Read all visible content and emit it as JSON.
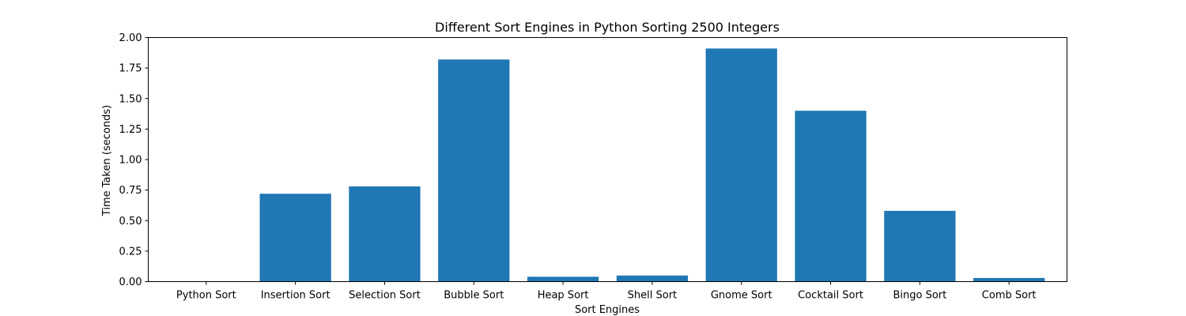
{
  "chart_data": {
    "type": "bar",
    "title": "Different Sort Engines in Python Sorting 2500 Integers",
    "xlabel": "Sort Engines",
    "ylabel": "Time Taken (seconds)",
    "categories": [
      "Python Sort",
      "Insertion Sort",
      "Selection Sort",
      "Bubble Sort",
      "Heap Sort",
      "Shell Sort",
      "Gnome Sort",
      "Cocktail Sort",
      "Bingo Sort",
      "Comb Sort"
    ],
    "values": [
      0.0,
      0.72,
      0.78,
      1.82,
      0.04,
      0.05,
      1.91,
      1.4,
      0.58,
      0.03
    ],
    "ylim": [
      0,
      2.0
    ],
    "yticks": [
      "0.00",
      "0.25",
      "0.50",
      "0.75",
      "1.00",
      "1.25",
      "1.50",
      "1.75",
      "2.00"
    ],
    "bar_color": "#1f77b4",
    "grid": false,
    "legend": "none"
  }
}
